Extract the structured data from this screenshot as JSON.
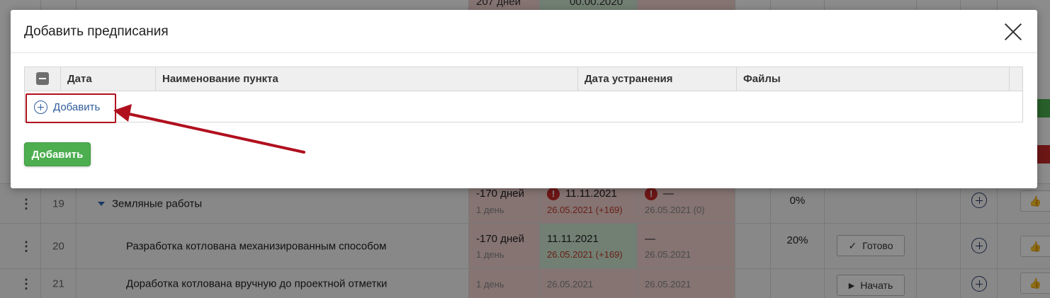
{
  "modal": {
    "title": "Добавить предписания",
    "table": {
      "columns": [
        "Дата",
        "Наименование пункта",
        "Дата устранения",
        "Файлы"
      ],
      "add_row_label": "Добавить"
    },
    "submit_label": "Добавить"
  },
  "background": {
    "top_peek": {
      "duration": "207 дней",
      "start": "00.00.2020"
    },
    "rows": [
      {
        "num": "19",
        "name": "Земляные работы",
        "duration": "-170 дней",
        "duration_sub": "1 день",
        "start": "11.11.2021",
        "start_sub": "26.05.2021 (+169)",
        "end": "—",
        "end_sub": "26.05.2021 (0)",
        "percent": "0%",
        "action": ""
      },
      {
        "num": "20",
        "name": "Разработка котлована механизированным способом",
        "duration": "-170 дней",
        "duration_sub": "1 день",
        "start": "11.11.2021",
        "start_sub": "26.05.2021 (+169)",
        "end": "—",
        "end_sub": "26.05.2021",
        "percent": "20%",
        "action": "Готово"
      },
      {
        "num": "21",
        "name": "Доработка котлована вручную до проектной отметки",
        "duration": "",
        "duration_sub": "1 день",
        "start": "",
        "start_sub": "26.05.2021",
        "end": "",
        "end_sub": "26.05.2021",
        "percent": "",
        "action": "Начать"
      }
    ]
  },
  "colors": {
    "accent_link": "#2f5d9c",
    "submit_green": "#4cae4f",
    "highlight_red": "#b0101e",
    "status_red_bg": "#f2d3cf",
    "status_green_bg": "#cfe9d1"
  },
  "icons": [
    "close-icon",
    "minus-checkbox-icon",
    "plus-circle-icon",
    "kebab-menu-icon",
    "warning-icon",
    "checkmark-icon",
    "play-icon",
    "thumbs-up-icon",
    "expand-triangle-icon",
    "annotation-arrow"
  ]
}
